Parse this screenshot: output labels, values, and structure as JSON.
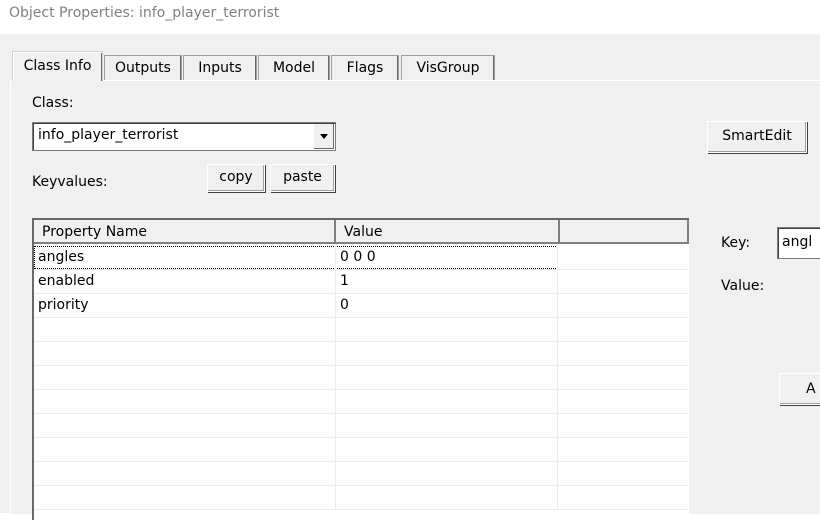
{
  "window": {
    "title": "Object Properties: info_player_terrorist"
  },
  "tabs": [
    {
      "label": "Class Info",
      "active": true
    },
    {
      "label": "Outputs",
      "active": false
    },
    {
      "label": "Inputs",
      "active": false
    },
    {
      "label": "Model",
      "active": false
    },
    {
      "label": "Flags",
      "active": false
    },
    {
      "label": "VisGroup",
      "active": false
    }
  ],
  "class_info": {
    "class_label": "Class:",
    "class_value": "info_player_terrorist",
    "keyvalues_label": "Keyvalues:",
    "copy_label": "copy",
    "paste_label": "paste",
    "smartedit_label": "SmartEdit",
    "key_label": "Key:",
    "key_value": "angl",
    "value_label": "Value:",
    "add_label": "A"
  },
  "table": {
    "columns": [
      "Property Name",
      "Value",
      ""
    ],
    "rows": [
      {
        "name": "angles",
        "value": "0 0 0"
      },
      {
        "name": "enabled",
        "value": "1"
      },
      {
        "name": "priority",
        "value": "0"
      }
    ]
  }
}
